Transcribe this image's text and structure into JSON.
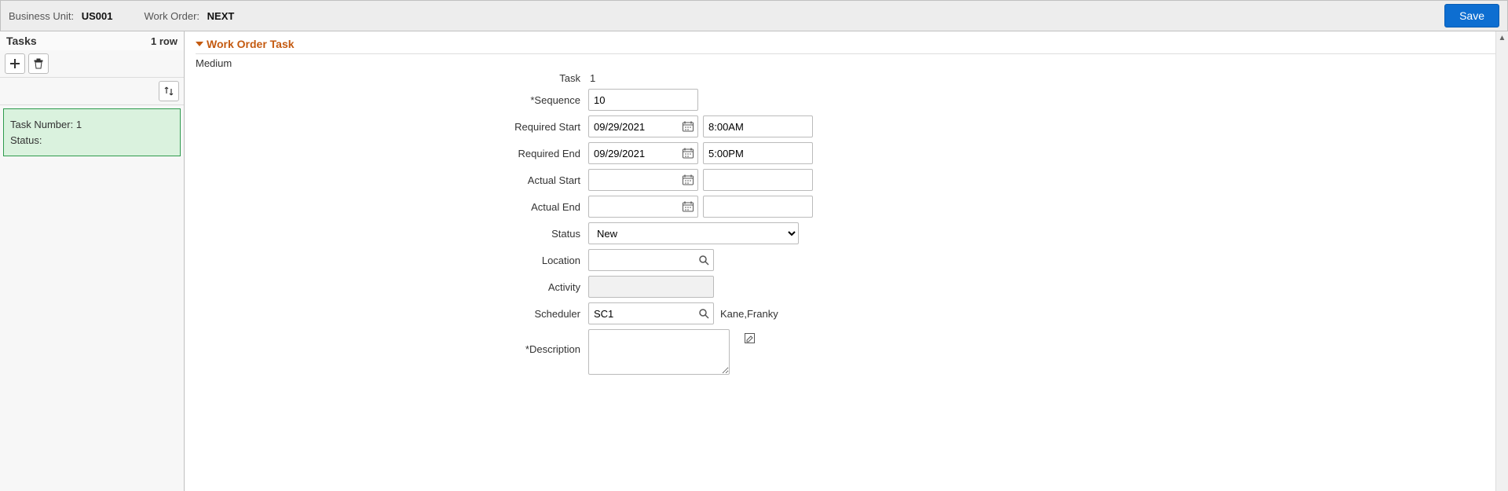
{
  "header": {
    "bu_label": "Business Unit:",
    "bu_value": "US001",
    "wo_label": "Work Order:",
    "wo_value": "NEXT",
    "save_label": "Save"
  },
  "sidebar": {
    "title": "Tasks",
    "row_count": "1 row",
    "task_card": {
      "line1_label": "Task Number:",
      "line1_value": "1",
      "line2_label": "Status:",
      "line2_value": ""
    }
  },
  "section": {
    "title": "Work Order Task",
    "priority": "Medium"
  },
  "form": {
    "task": {
      "label": "Task",
      "value": "1"
    },
    "sequence": {
      "label": "*Sequence",
      "value": "10"
    },
    "req_start": {
      "label": "Required Start",
      "date": "09/29/2021",
      "time": "8:00AM"
    },
    "req_end": {
      "label": "Required End",
      "date": "09/29/2021",
      "time": "5:00PM"
    },
    "act_start": {
      "label": "Actual Start",
      "date": "",
      "time": ""
    },
    "act_end": {
      "label": "Actual End",
      "date": "",
      "time": ""
    },
    "status": {
      "label": "Status",
      "value": "New"
    },
    "location": {
      "label": "Location",
      "value": ""
    },
    "activity": {
      "label": "Activity",
      "value": ""
    },
    "scheduler": {
      "label": "Scheduler",
      "value": "SC1",
      "name": "Kane,Franky"
    },
    "description": {
      "label": "*Description",
      "value": ""
    }
  }
}
